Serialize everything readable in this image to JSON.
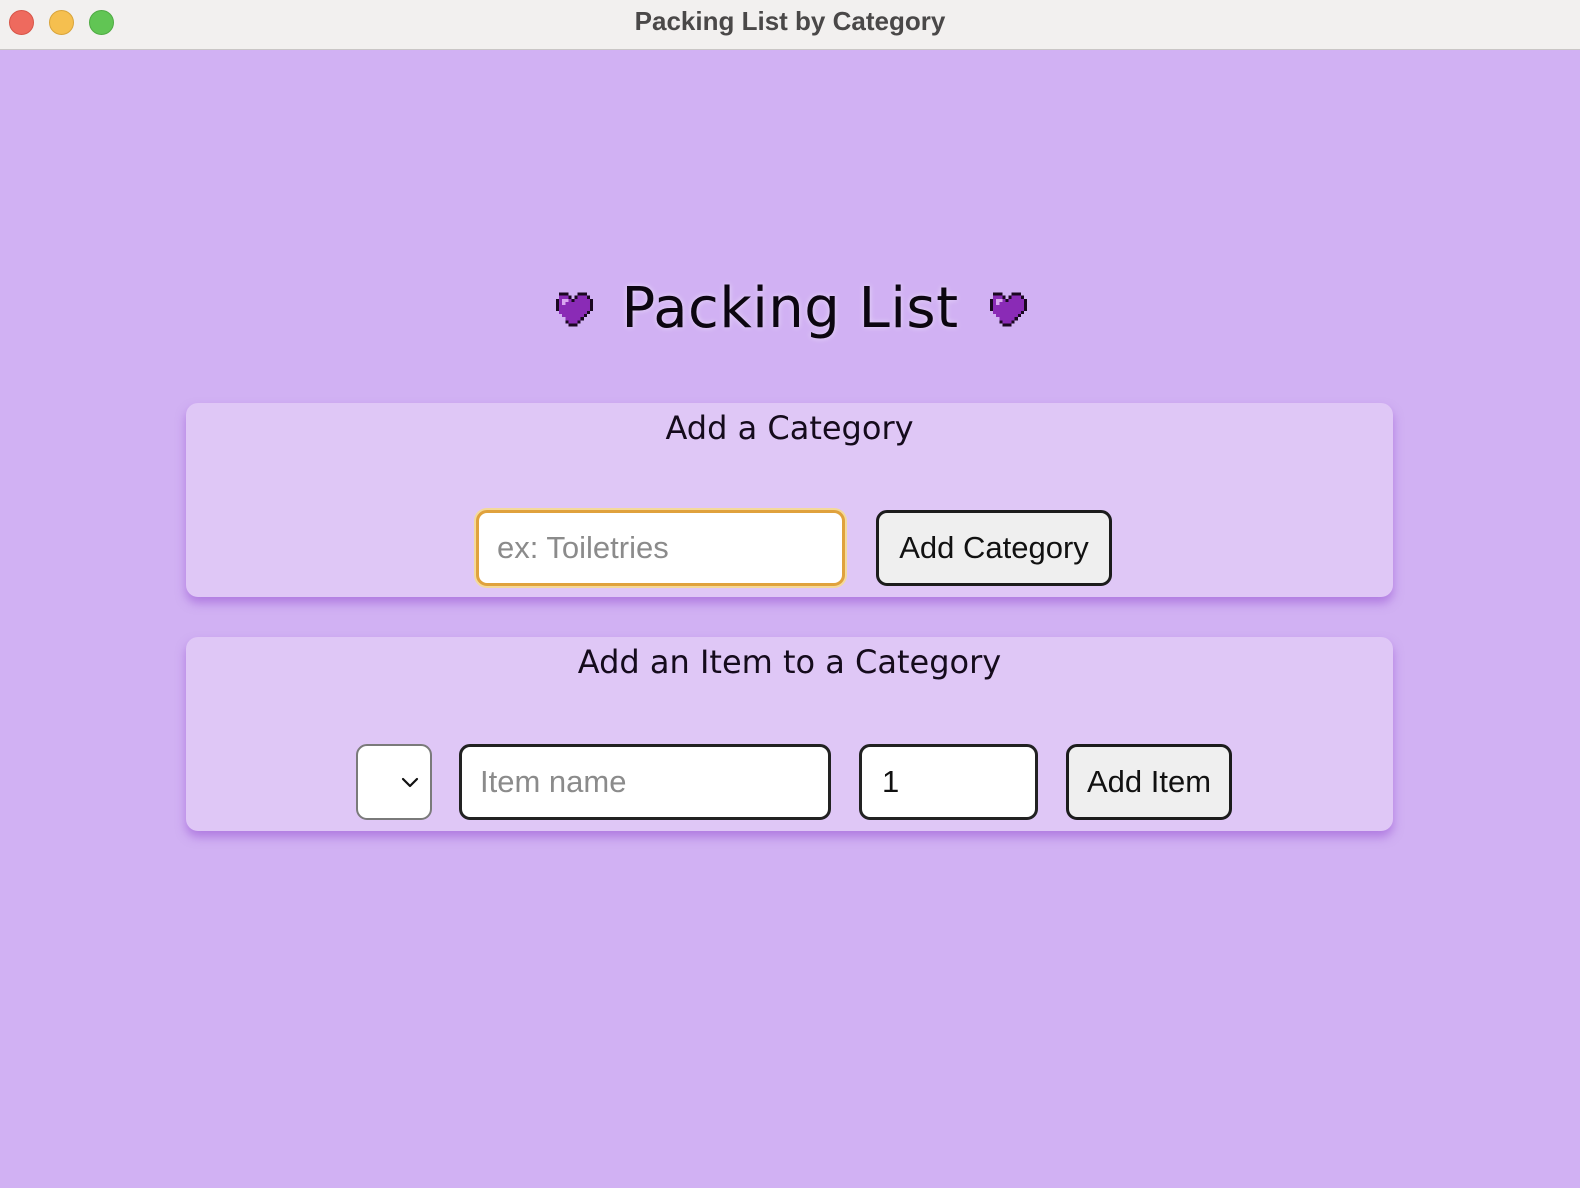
{
  "window": {
    "title": "Packing List by Category"
  },
  "header": {
    "title": "Packing List"
  },
  "add_category": {
    "title": "Add a Category",
    "input_placeholder": "ex: Toiletries",
    "input_value": "",
    "button_label": "Add Category"
  },
  "add_item": {
    "title": "Add an Item to a Category",
    "category_select_value": "",
    "item_placeholder": "Item name",
    "item_value": "",
    "quantity_value": "1",
    "button_label": "Add Item"
  },
  "colors": {
    "background": "#d1b1f3",
    "card": "#dfc7f6",
    "focus_border": "#e0a23d",
    "heart": "#8a2bb6"
  },
  "icons": {
    "header_left": "purple-heart-icon",
    "header_right": "purple-heart-icon",
    "select": "chevron-down-icon"
  }
}
